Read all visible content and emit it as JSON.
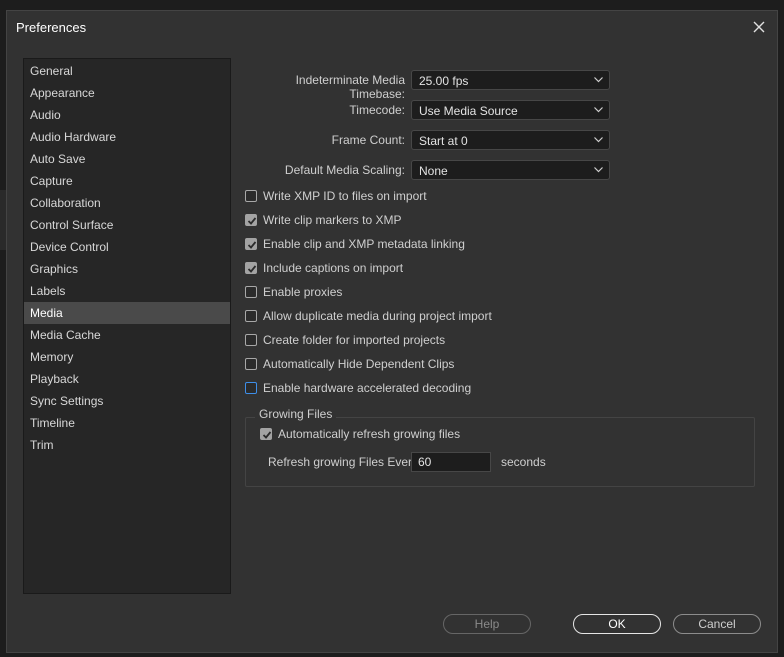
{
  "window": {
    "title": "Preferences"
  },
  "sidebar": {
    "items": [
      {
        "label": "General"
      },
      {
        "label": "Appearance"
      },
      {
        "label": "Audio"
      },
      {
        "label": "Audio Hardware"
      },
      {
        "label": "Auto Save"
      },
      {
        "label": "Capture"
      },
      {
        "label": "Collaboration"
      },
      {
        "label": "Control Surface"
      },
      {
        "label": "Device Control"
      },
      {
        "label": "Graphics"
      },
      {
        "label": "Labels"
      },
      {
        "label": "Media",
        "selected": true
      },
      {
        "label": "Media Cache"
      },
      {
        "label": "Memory"
      },
      {
        "label": "Playback"
      },
      {
        "label": "Sync Settings"
      },
      {
        "label": "Timeline"
      },
      {
        "label": "Trim"
      }
    ]
  },
  "fields": {
    "timebase": {
      "label": "Indeterminate Media Timebase:",
      "value": "25.00 fps"
    },
    "timecode": {
      "label": "Timecode:",
      "value": "Use Media Source"
    },
    "frame_count": {
      "label": "Frame Count:",
      "value": "Start at 0"
    },
    "scaling": {
      "label": "Default Media Scaling:",
      "value": "None"
    }
  },
  "checkboxes": [
    {
      "label": "Write XMP ID to files on import",
      "checked": false
    },
    {
      "label": "Write clip markers to XMP",
      "checked": true
    },
    {
      "label": "Enable clip and XMP metadata linking",
      "checked": true
    },
    {
      "label": "Include captions on import",
      "checked": true
    },
    {
      "label": "Enable proxies",
      "checked": false
    },
    {
      "label": "Allow duplicate media during project import",
      "checked": false
    },
    {
      "label": "Create folder for imported projects",
      "checked": false
    },
    {
      "label": "Automatically Hide Dependent Clips",
      "checked": false
    },
    {
      "label": "Enable hardware accelerated decoding",
      "checked": false,
      "focused": true
    }
  ],
  "growing_files": {
    "title": "Growing Files",
    "auto_refresh": {
      "label": "Automatically refresh growing files",
      "checked": true
    },
    "refresh_label": "Refresh growing Files Every",
    "refresh_value": "60",
    "refresh_unit": "seconds"
  },
  "buttons": {
    "help": "Help",
    "ok": "OK",
    "cancel": "Cancel"
  }
}
